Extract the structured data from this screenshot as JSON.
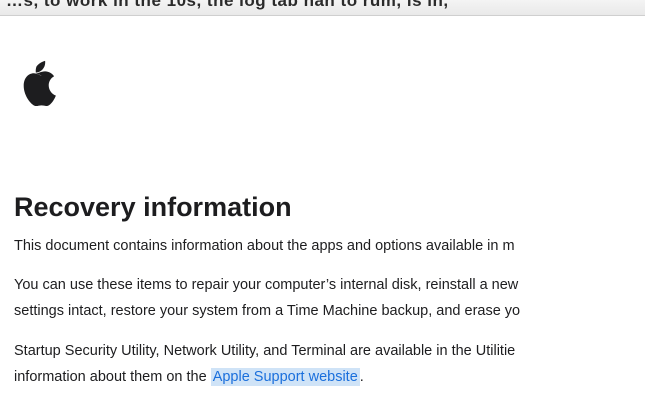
{
  "top_strip": {
    "text": "…s, to work in the 10s, the log tab nan to rum, is in,"
  },
  "logo": {
    "icon": "apple-logo-icon",
    "color": "#1d1d1f"
  },
  "document": {
    "title": "Recovery information",
    "paragraphs": [
      {
        "lines": [
          "This document contains information about the apps and options available in m"
        ]
      },
      {
        "lines": [
          "You can use these items to repair your computer’s internal disk, reinstall a new",
          "settings intact, restore your system from a Time Machine backup, and erase yo"
        ]
      },
      {
        "line1": "Startup Security Utility, Network Utility, and Terminal are available in the Utilitie",
        "line2_prefix": "information about them on the ",
        "link_text": "Apple Support website",
        "line2_suffix": "."
      }
    ]
  },
  "colors": {
    "text": "#1d1d1f",
    "link": "#1a6fdc",
    "link_highlight": "#cfe3f7"
  }
}
